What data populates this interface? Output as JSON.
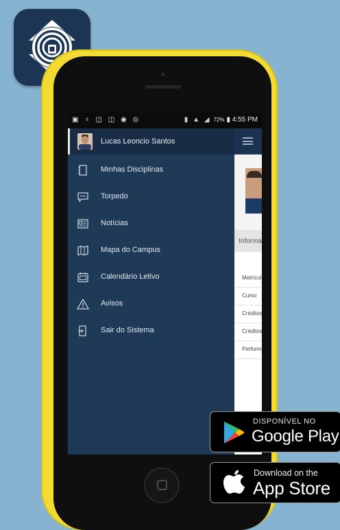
{
  "status_bar": {
    "left_icons": [
      "notification-icons"
    ],
    "battery_percent": "72%",
    "time": "4:55 PM"
  },
  "drawer": {
    "user_name": "Lucas Leoncio Santos",
    "items": [
      {
        "label": "Minhas Disciplinas",
        "icon": "notebook-icon"
      },
      {
        "label": "Torpedo",
        "icon": "message-icon"
      },
      {
        "label": "Notícias",
        "icon": "news-icon"
      },
      {
        "label": "Mapa do Campus",
        "icon": "map-icon"
      },
      {
        "label": "Calendário Letivo",
        "icon": "calendar-icon"
      },
      {
        "label": "Avisos",
        "icon": "warning-icon"
      },
      {
        "label": "Sair do Sistema",
        "icon": "exit-icon"
      }
    ]
  },
  "content": {
    "section_header": "Informações",
    "rows": [
      "Matrícula",
      "Curso",
      "Créditos",
      "Créditos",
      "Performance"
    ]
  },
  "badges": {
    "google_play": {
      "small": "DISPONÍVEL NO",
      "big": "Google Play"
    },
    "app_store": {
      "small": "Download on the",
      "big": "App Store"
    }
  },
  "colors": {
    "background": "#86b3d0",
    "phone_shell": "#f2dc32",
    "drawer": "#1f3a57",
    "app_icon": "#1c3552"
  }
}
